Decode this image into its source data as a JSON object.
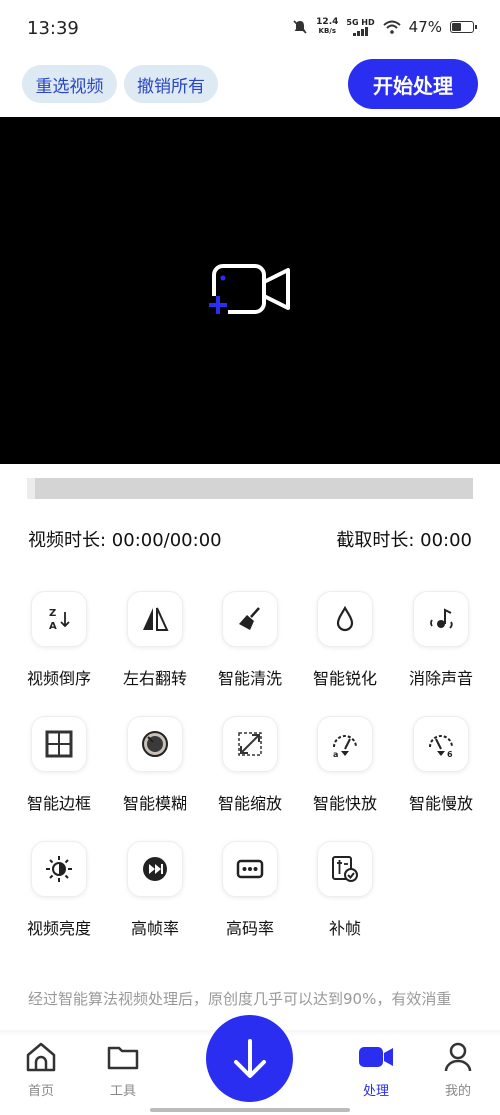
{
  "status": {
    "time": "13:39",
    "net_speed_value": "12.4",
    "net_speed_unit": "KB/s",
    "network": "5G HD",
    "battery": "47%"
  },
  "toolbar": {
    "reselect_label": "重选视频",
    "undo_label": "撤销所有",
    "start_label": "开始处理"
  },
  "durations": {
    "video_duration": "视频时长: 00:00/00:00",
    "clip_duration": "截取时长: 00:00"
  },
  "tools": [
    {
      "label": "视频倒序",
      "icon": "sort-reverse-icon"
    },
    {
      "label": "左右翻转",
      "icon": "flip-horizontal-icon"
    },
    {
      "label": "智能清洗",
      "icon": "broom-icon"
    },
    {
      "label": "智能锐化",
      "icon": "drop-icon"
    },
    {
      "label": "消除声音",
      "icon": "mute-music-icon"
    },
    {
      "label": "智能边框",
      "icon": "border-frame-icon"
    },
    {
      "label": "智能模糊",
      "icon": "blur-lens-icon"
    },
    {
      "label": "智能缩放",
      "icon": "resize-arrows-icon"
    },
    {
      "label": "智能快放",
      "icon": "speedometer-fast-icon"
    },
    {
      "label": "智能慢放",
      "icon": "speedometer-slow-icon"
    },
    {
      "label": "视频亮度",
      "icon": "brightness-icon"
    },
    {
      "label": "高帧率",
      "icon": "fast-forward-circle-icon"
    },
    {
      "label": "高码率",
      "icon": "bitrate-dots-icon"
    },
    {
      "label": "补帧",
      "icon": "frame-fill-icon"
    }
  ],
  "info": {
    "text": "经过智能算法视频处理后，原创度几乎可以达到90%，有效消重"
  },
  "nav": {
    "home": "首页",
    "tools": "工具",
    "process": "处理",
    "mine": "我的"
  },
  "colors": {
    "accent": "#2a2ef0",
    "pill_bg": "#dde9f3",
    "pill_text": "#2a46c4"
  }
}
